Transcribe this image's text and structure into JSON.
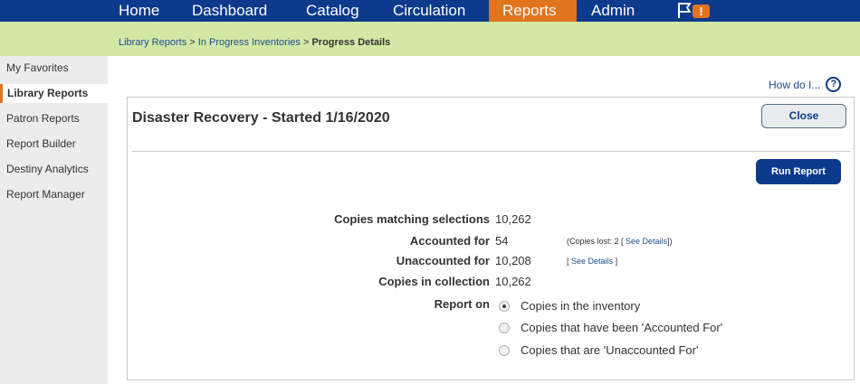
{
  "nav": {
    "items": [
      "Home",
      "Dashboard",
      "Catalog",
      "Circulation",
      "Reports",
      "Admin"
    ],
    "active": "Reports",
    "alert_badge": "!"
  },
  "breadcrumb": {
    "links": [
      "Library Reports",
      "In Progress Inventories"
    ],
    "separator": ">",
    "current": "Progress Details"
  },
  "sidebar": {
    "items": [
      "My Favorites",
      "Library Reports",
      "Patron Reports",
      "Report Builder",
      "Destiny Analytics",
      "Report Manager"
    ],
    "active": "Library Reports"
  },
  "help": {
    "label": "How do I...",
    "icon": "?"
  },
  "panel": {
    "title": "Disaster Recovery - Started",
    "date": "1/16/2020",
    "close_label": "Close",
    "run_label": "Run Report"
  },
  "stats": {
    "copies_matching": {
      "label": "Copies matching selections",
      "value": "10,262"
    },
    "accounted_for": {
      "label": "Accounted for",
      "value": "54",
      "note_prefix": "(Copies lost: 2 [",
      "note_link": "See Details",
      "note_suffix": "])"
    },
    "unaccounted_for": {
      "label": "Unaccounted for",
      "value": "10,208",
      "note_prefix": "[",
      "note_link": "See Details",
      "note_suffix": "]"
    },
    "in_collection": {
      "label": "Copies in collection",
      "value": "10,262"
    }
  },
  "report_on": {
    "label": "Report on",
    "options": [
      "Copies in the inventory",
      "Copies that have been 'Accounted For'",
      "Copies that are 'Unaccounted For'"
    ],
    "selected_index": 0
  },
  "colors": {
    "nav_bg": "#0d3a8c",
    "accent": "#e0741f",
    "crumb_bg": "#d2e8a4",
    "sidebar_bg": "#ececec"
  }
}
